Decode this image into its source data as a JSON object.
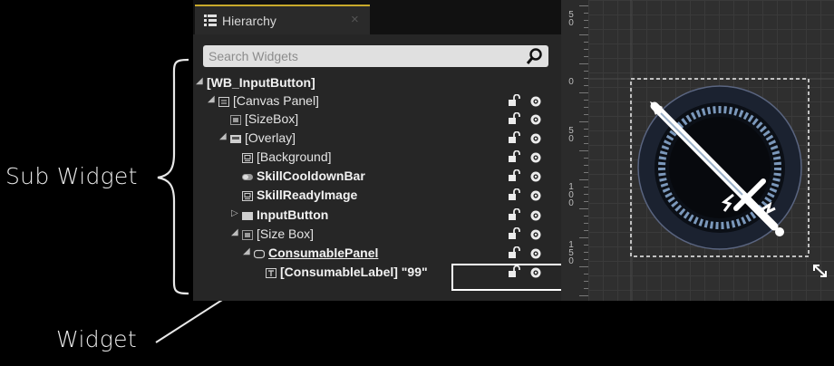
{
  "annotations": {
    "sub_widget": "Sub Widget",
    "widget": "Widget"
  },
  "hierarchy_panel": {
    "tab_title": "Hierarchy",
    "tab_close": "×",
    "search_placeholder": "Search Widgets",
    "rows": [
      {
        "label": "[WB_InputButton]",
        "indent": 0,
        "arrow": "◢",
        "icon": "none",
        "bold": true,
        "underline": false,
        "lock": false,
        "eye": false
      },
      {
        "label": "[Canvas Panel]",
        "indent": 1,
        "arrow": "◢",
        "icon": "canvas-panel-icon",
        "bold": false,
        "underline": false,
        "lock": true,
        "eye": true
      },
      {
        "label": "[SizeBox]",
        "indent": 2,
        "arrow": "",
        "icon": "sizebox-icon",
        "bold": false,
        "underline": false,
        "lock": true,
        "eye": true
      },
      {
        "label": "[Overlay]",
        "indent": 2,
        "arrow": "◢",
        "icon": "overlay-icon",
        "bold": false,
        "underline": false,
        "lock": true,
        "eye": true
      },
      {
        "label": "[Background]",
        "indent": 3,
        "arrow": "",
        "icon": "image-icon",
        "bold": false,
        "underline": false,
        "lock": true,
        "eye": true
      },
      {
        "label": "SkillCooldownBar",
        "indent": 3,
        "arrow": "",
        "icon": "progressbar-icon",
        "bold": true,
        "underline": false,
        "lock": true,
        "eye": true
      },
      {
        "label": "SkillReadyImage",
        "indent": 3,
        "arrow": "",
        "icon": "image-icon",
        "bold": true,
        "underline": false,
        "lock": true,
        "eye": true
      },
      {
        "label": "InputButton",
        "indent": 3,
        "arrow": "▷",
        "icon": "button-icon",
        "bold": true,
        "underline": false,
        "lock": true,
        "eye": true
      },
      {
        "label": "[Size Box]",
        "indent": 3,
        "arrow": "◢",
        "icon": "sizebox-icon",
        "bold": false,
        "underline": false,
        "lock": true,
        "eye": true
      },
      {
        "label": "ConsumablePanel",
        "indent": 4,
        "arrow": "◢",
        "icon": "border-icon",
        "bold": true,
        "underline": true,
        "lock": true,
        "eye": true
      },
      {
        "label": "[ConsumableLabel] \"99\"",
        "indent": 5,
        "arrow": "",
        "icon": "text-icon",
        "bold": true,
        "underline": false,
        "lock": true,
        "eye": true
      }
    ]
  },
  "ruler": {
    "labels": [
      {
        "text": "5\n0",
        "pos": 12
      },
      {
        "text": "0",
        "pos": 86
      },
      {
        "text": "5\n0",
        "pos": 140
      },
      {
        "text": "1\n0\n0",
        "pos": 202
      },
      {
        "text": "1\n5\n0",
        "pos": 266
      }
    ]
  },
  "colors": {
    "accent": "#c8a92b",
    "panel_bg": "#262626",
    "highlight": "#ffffff"
  }
}
